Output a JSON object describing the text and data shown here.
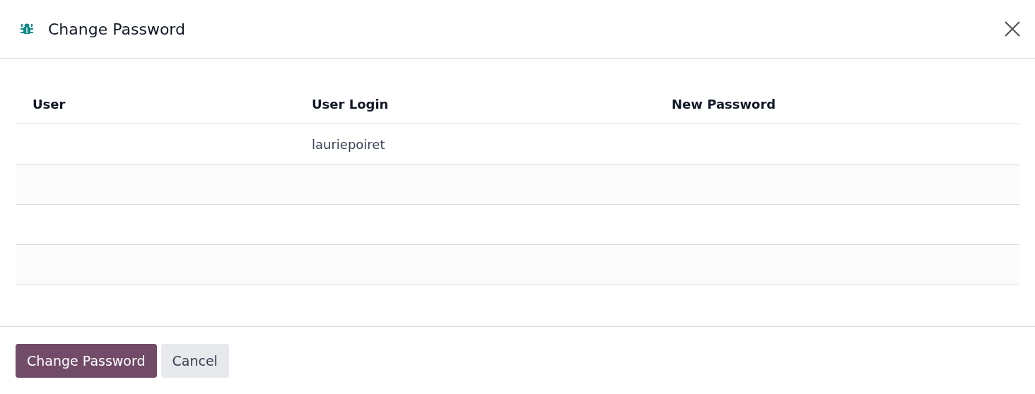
{
  "dialog": {
    "title": "Change Password"
  },
  "table": {
    "columns": [
      "User",
      "User Login",
      "New Password"
    ],
    "rows": [
      {
        "user_login": "lauriepoiret"
      }
    ]
  },
  "buttons": [
    {
      "label": "Change Password",
      "kind": "primary"
    },
    {
      "label": "Cancel",
      "kind": "secondary"
    }
  ]
}
